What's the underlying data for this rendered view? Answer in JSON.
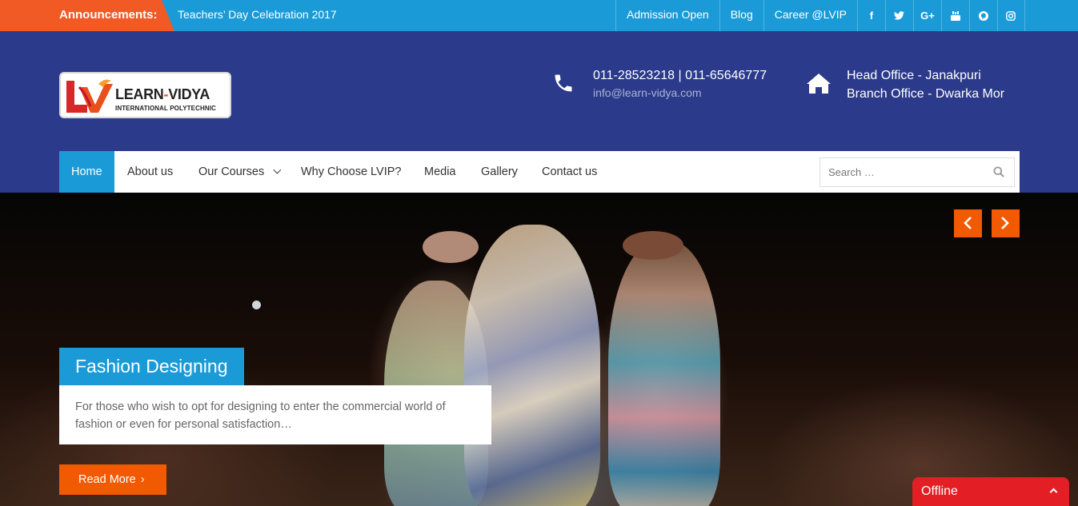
{
  "topbar": {
    "announcement_label": "Announcements:",
    "announcement_text": "Teachers’ Day Celebration 2017",
    "links": [
      "Admission Open",
      "Blog",
      "Career @LVIP"
    ],
    "social_icons": [
      "facebook-icon",
      "twitter-icon",
      "google-plus-icon",
      "youtube-icon",
      "pinterest-icon",
      "instagram-icon"
    ],
    "social_glyphs": [
      "f",
      "t",
      "G+",
      "▶",
      "P",
      "◎"
    ]
  },
  "header": {
    "logo": {
      "brand_left": "LEARN",
      "brand_dash": "-",
      "brand_right": "VIDYA",
      "subtitle": "INTERNATIONAL POLYTECHNIC"
    },
    "phone": "011-28523218 | 011-65646777",
    "email": "info@learn-vidya.com",
    "office_head": "Head Office - Janakpuri",
    "office_branch": "Branch Office - Dwarka Mor"
  },
  "nav": {
    "items": [
      "Home",
      "About us",
      "Our Courses",
      "Why Choose LVIP?",
      "Media",
      "Gallery",
      "Contact us"
    ],
    "search_placeholder": "Search …"
  },
  "hero": {
    "title": "Fashion Designing",
    "description": "For those who wish to opt for designing to enter the commercial world of fashion or even for personal satisfaction…",
    "button": "Read More"
  },
  "chat": {
    "status": "Offline"
  },
  "colors": {
    "accent_blue": "#1a9bd8",
    "header_navy": "#2b3a8a",
    "accent_orange": "#f15a00",
    "offline_red": "#e31e24"
  }
}
